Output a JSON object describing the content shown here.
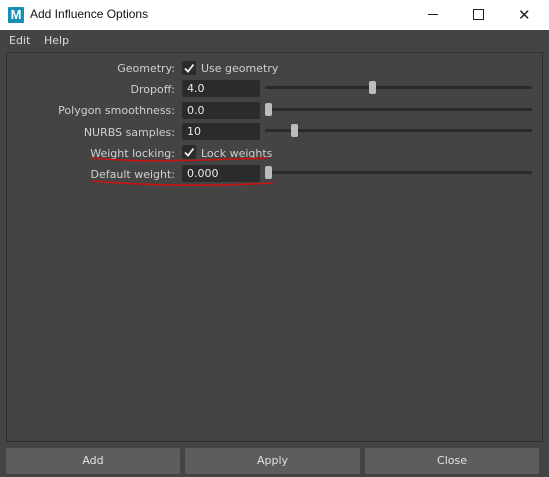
{
  "window": {
    "title": "Add Influence Options",
    "app_icon_letter": "M",
    "app_icon_color": "#1a8fb5"
  },
  "menu": {
    "items": [
      {
        "label": "Edit"
      },
      {
        "label": "Help"
      }
    ]
  },
  "options": {
    "geometry": {
      "label": "Geometry:",
      "checkbox_label": "Use geometry",
      "checked": true
    },
    "dropoff": {
      "label": "Dropoff:",
      "value": "4.0",
      "slider_fraction": 0.4
    },
    "polygon_smoothness": {
      "label": "Polygon smoothness:",
      "value": "0.0",
      "slider_fraction": 0.0
    },
    "nurbs_samples": {
      "label": "NURBS samples:",
      "value": "10",
      "slider_fraction": 0.1
    },
    "weight_locking": {
      "label": "Weight locking:",
      "checkbox_label": "Lock weights",
      "checked": true
    },
    "default_weight": {
      "label": "Default weight:",
      "value": "0.000",
      "slider_fraction": 0.0
    }
  },
  "buttons": {
    "add": "Add",
    "apply": "Apply",
    "close": "Close"
  },
  "colors": {
    "background": "#444444",
    "field": "#2b2b2b",
    "annotation": "#cc1111"
  }
}
